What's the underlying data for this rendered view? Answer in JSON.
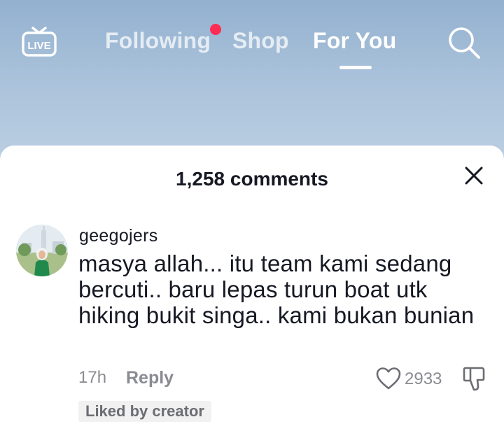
{
  "header": {
    "live_label": "LIVE",
    "tabs": [
      {
        "label": "Following",
        "has_notification_dot": true
      },
      {
        "label": "Shop"
      },
      {
        "label": "For You",
        "active": true
      }
    ],
    "live_icon": "live-tv-icon",
    "search_icon": "search-icon"
  },
  "comments_panel": {
    "title": "1,258 comments",
    "close_icon": "close-icon"
  },
  "comment": {
    "username": "geegojers",
    "text": "masya allah... itu team kami sedang bercuti.. baru lepas turun boat utk hiking bukit singa.. kami bukan bunian",
    "time": "17h",
    "reply_label": "Reply",
    "like_count": "2933",
    "liked_by_creator": "Liked by creator",
    "like_icon": "heart-outline-icon",
    "dislike_icon": "thumbs-down-icon"
  },
  "colors": {
    "notification_dot": "#fe2c55",
    "text_primary": "#161823",
    "text_secondary": "#8a8b91"
  }
}
